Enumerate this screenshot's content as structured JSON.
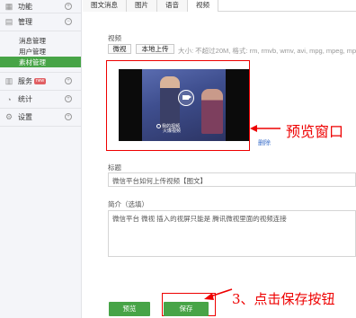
{
  "sidebar": {
    "groups": [
      {
        "label": "功能",
        "icon": "grid-icon"
      },
      {
        "label": "管理",
        "icon": "folder-icon",
        "items": [
          "消息管理",
          "用户管理",
          "素材管理"
        ],
        "active_item": "素材管理"
      },
      {
        "label": "服务",
        "icon": "service-icon",
        "badge": "new"
      },
      {
        "label": "统计",
        "icon": "chart-icon"
      },
      {
        "label": "设置",
        "icon": "settings-icon"
      }
    ]
  },
  "tabs": [
    "图文消息",
    "图片",
    "语音",
    "视频"
  ],
  "active_tab": "视频",
  "video_section": {
    "label": "视频",
    "buttons": {
      "video": "微视",
      "local_upload": "本地上传"
    },
    "hint": "大小: 不超过20M, 格式: rm, rmvb, wmv, avi, mpg, mpeg, mp4",
    "watermark": "我的视频",
    "watermark_small": "火爆视频",
    "delete_link": "删除"
  },
  "title_field": {
    "label": "标题",
    "value": "微信平台如何上传视频【图文】"
  },
  "intro_field": {
    "label": "简介（选填）",
    "value": "微信平台 微视 插入的视屏只能是 腾讯微视里面的视频连接"
  },
  "actions": {
    "preview": "预览",
    "save": "保存"
  },
  "annotations": {
    "preview_window": "预览窗口",
    "save_step": "3、点击保存按钮"
  },
  "colors": {
    "accent": "#47a447",
    "annotation": "#e00000",
    "link": "#3a6ec9"
  }
}
